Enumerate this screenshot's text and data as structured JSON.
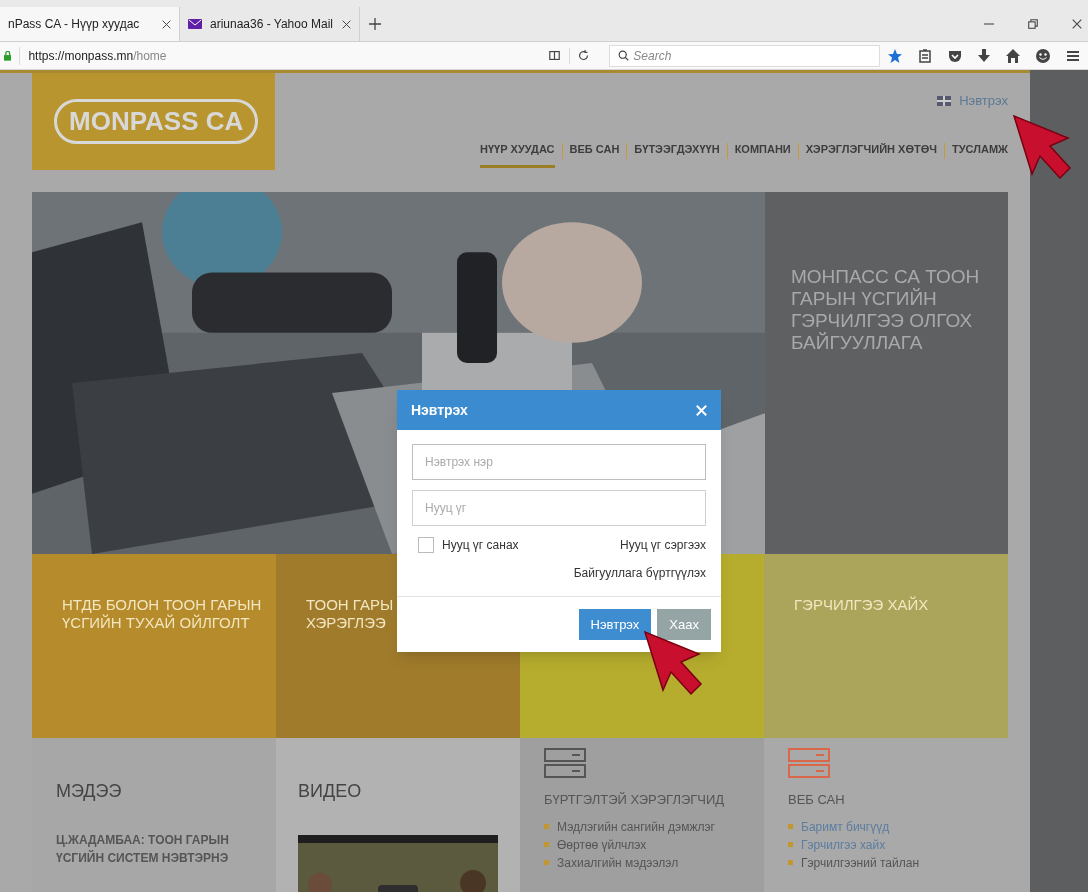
{
  "browser": {
    "tabs": [
      {
        "title": "nPass CA - Нүүр хуудас",
        "selected": true
      },
      {
        "title": "ariunaa36 - Yahoo Mail",
        "selected": false
      }
    ],
    "url_domain": "https://monpass.mn",
    "url_path": "/home",
    "search_placeholder": "Search"
  },
  "header": {
    "logo": "MONPASS CA",
    "login_link": "Нэвтрэх",
    "nav": [
      {
        "label": "НҮҮР ХУУДАС",
        "selected": true
      },
      {
        "label": "ВЕБ САН",
        "selected": false
      },
      {
        "label": "БҮТЭЭГДЭХҮҮН",
        "selected": false
      },
      {
        "label": "КОМПАНИ",
        "selected": false
      },
      {
        "label": "ХЭРЭГЛЭГЧИЙН ХӨТӨЧ",
        "selected": false
      },
      {
        "label": "ТУСЛАМЖ",
        "selected": false
      }
    ]
  },
  "hero": {
    "headline": "МОНПАСС СА ТООН ГАРЫН ҮСГИЙН ГЭРЧИЛГЭЭ ОЛГОХ БАЙГУУЛЛАГА"
  },
  "tiles": [
    {
      "lines": [
        "НТДБ БОЛОН ТООН ГАРЫН",
        "ҮСГИЙН ТУХАЙ ОЙЛГОЛТ"
      ],
      "color": "#b58b2c"
    },
    {
      "lines": [
        "ТООН ГАРЫ",
        "ХЭРЭГЛЭЭ"
      ],
      "color": "#a07b2c"
    },
    {
      "color": "#b6ad2e"
    },
    {
      "lines": [
        "ГЭРЧИЛГЭЭ ХАЙХ"
      ],
      "color": "#aba55c"
    }
  ],
  "modal": {
    "title": "Нэвтрэх",
    "username_placeholder": "Нэвтрэх нэр",
    "password_placeholder": "Нууц үг",
    "remember": {
      "label": "Нууц үг санах",
      "checked": false
    },
    "links": [
      "Нууц үг сэргээх",
      "Байгууллага бүртгүүлэх"
    ],
    "buttons": [
      {
        "label": "Нэвтрэх",
        "kind": "primary"
      },
      {
        "label": "Хаах",
        "kind": "secondary"
      }
    ]
  },
  "bottom": {
    "news": {
      "title": "МЭДЭЭ",
      "headline_lines": [
        "Ц.ЖАДАМБАА: ТООН ГАРЫН",
        "ҮСГИЙН СИСТЕМ НЭВТЭРНЭ"
      ]
    },
    "video": {
      "title": "ВИДЕО"
    },
    "lists": [
      {
        "title": "БҮРТГЭЛТЭЙ ХЭРЭГЛЭГЧИД",
        "color": "#555555",
        "items": [
          {
            "text": "Мэдлэгийн сангийн дэмжлэг",
            "link": false
          },
          {
            "text": "Өөртөө үйлчлэх",
            "link": false
          },
          {
            "text": "Захиалгийн мэдээлэл",
            "link": false
          }
        ]
      },
      {
        "title": "ВЕБ САН",
        "color": "#d9684a",
        "items": [
          {
            "text": "Баримт бичгүүд",
            "link": true
          },
          {
            "text": "Гэрчилгээ хайх",
            "link": true
          },
          {
            "text": "Гэрчилгээний тайлан",
            "link": false
          }
        ]
      }
    ]
  }
}
